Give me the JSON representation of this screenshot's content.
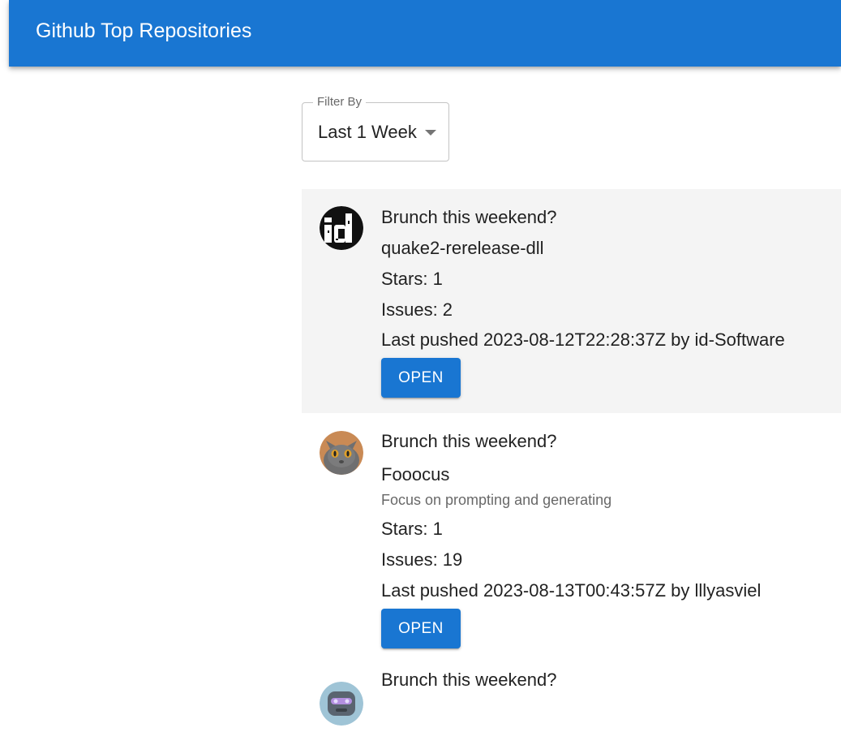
{
  "appbar": {
    "title": "Github Top Repositories"
  },
  "filter": {
    "label": "Filter By",
    "value": "Last 1 Week"
  },
  "colors": {
    "primary": "#1976d2",
    "selected_row": "#f4f4f4"
  },
  "repos": [
    {
      "heading": "Brunch this weekend?",
      "name": "quake2-rerelease-dll",
      "description": "",
      "stars": "Stars: 1",
      "issues": "Issues: 2",
      "pushed": "Last pushed 2023-08-12T22:28:37Z by id-Software",
      "button_label": "OPEN",
      "avatar_icon": "id-software-logo"
    },
    {
      "heading": "Brunch this weekend?",
      "name": "Fooocus",
      "description": "Focus on prompting and generating",
      "stars": "Stars: 1",
      "issues": "Issues: 19",
      "pushed": "Last pushed 2023-08-13T00:43:57Z by lllyasviel",
      "button_label": "OPEN",
      "avatar_icon": "cat-avatar"
    },
    {
      "heading": "Brunch this weekend?",
      "avatar_icon": "robot-avatar"
    }
  ]
}
